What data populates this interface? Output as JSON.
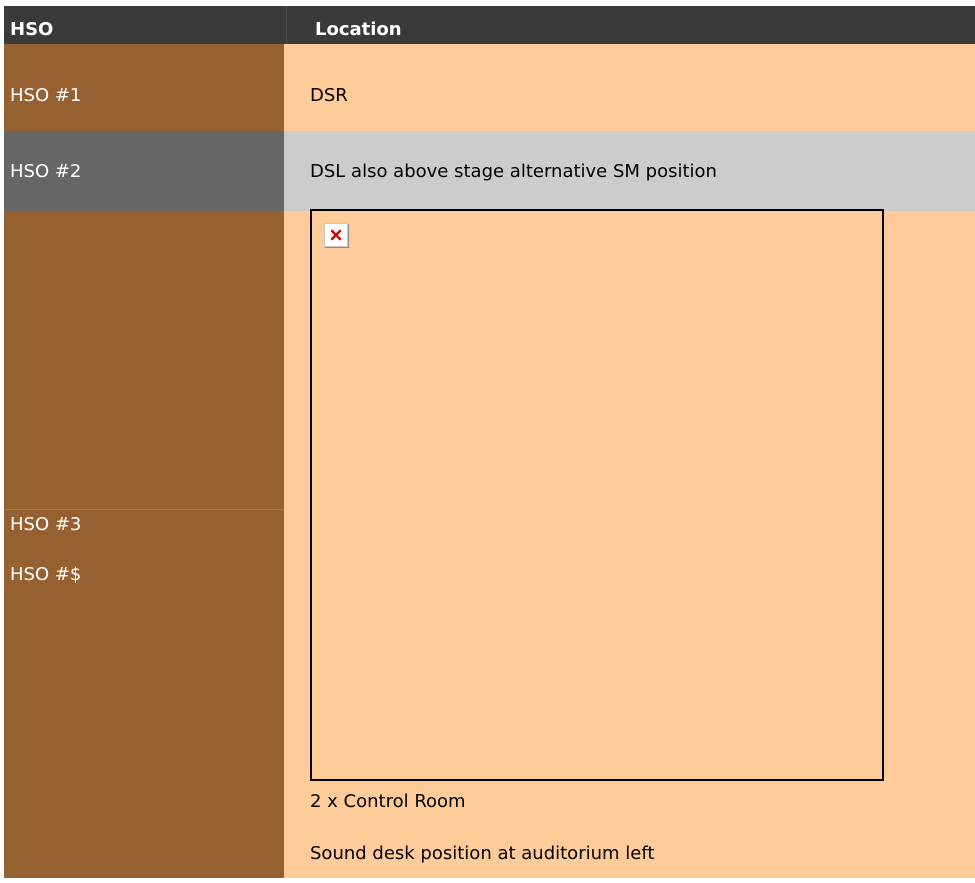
{
  "header": {
    "hso_label": "HSO",
    "location_label": "Location"
  },
  "rows": [
    {
      "hso": "HSO #1",
      "location": "DSR"
    },
    {
      "hso": "HSO #2",
      "location": "DSL  also above stage alternative SM position"
    },
    {
      "hso": "HSO #3",
      "location": "2 x Control Room"
    },
    {
      "hso": "HSO #$",
      "location": "Sound desk position at auditorium left"
    }
  ],
  "icons": {
    "broken_image": "broken-image-icon"
  },
  "colors": {
    "header_bg": "#3a3a3a",
    "hso_column_bg": "#966031",
    "location_column_bg": "#ffcc99",
    "highlight_left_bg": "#666666",
    "highlight_right_bg": "#cccccc",
    "broken_image_cross": "#cc0000"
  }
}
